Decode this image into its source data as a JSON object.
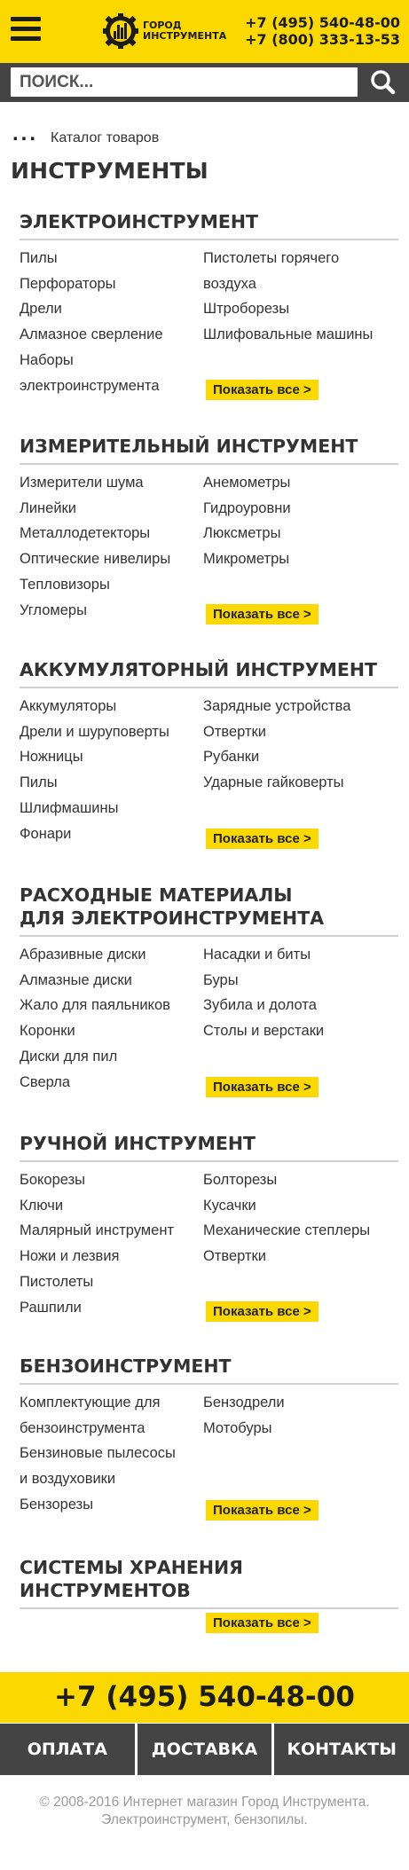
{
  "header": {
    "logo_line1": "ГОРОД",
    "logo_line2": "ИНСТРУМЕНТА",
    "phone1": "+7 (495) 540-48-00",
    "phone2": "+7 (800) 333-13-53"
  },
  "search": {
    "placeholder": "ПОИСК..."
  },
  "breadcrumb": {
    "dots": "...",
    "link": "Каталог товаров"
  },
  "page_title": "ИНСТРУМЕНТЫ",
  "show_all_label": "Показать все >",
  "sections": [
    {
      "title_lines": [
        "ЭЛЕКТРОИНСТРУМЕНТ"
      ],
      "left": [
        "Пилы",
        "Перфораторы",
        "Дрели",
        "Алмазное сверление",
        "Наборы",
        "электроинструмента"
      ],
      "right": [
        "Пистолеты горячего",
        "воздуха",
        "Штроборезы",
        "Шлифовальные машины"
      ]
    },
    {
      "title_lines": [
        "ИЗМЕРИТЕЛЬНЫЙ ИНСТРУМЕНТ"
      ],
      "left": [
        "Измерители шума",
        "Линейки",
        "Металлодетекторы",
        "Оптические нивелиры",
        "Тепловизоры",
        "Угломеры"
      ],
      "right": [
        "Анемометры",
        "Гидроуровни",
        "Люксметры",
        "Микрометры"
      ]
    },
    {
      "title_lines": [
        "АККУМУЛЯТОРНЫЙ ИНСТРУМЕНТ"
      ],
      "left": [
        "Аккумуляторы",
        "Дрели и шуруповерты",
        "Ножницы",
        "Пилы",
        "Шлифмашины",
        "Фонари"
      ],
      "right": [
        "Зарядные устройства",
        "Отвертки",
        "Рубанки",
        "Ударные гайковерты"
      ]
    },
    {
      "title_lines": [
        "РАСХОДНЫЕ МАТЕРИАЛЫ",
        "ДЛЯ ЭЛЕКТРОИНСТРУМЕНТА"
      ],
      "left": [
        "Абразивные диски",
        "Алмазные диски",
        "Жало для паяльников",
        "Коронки",
        "Диски для пил",
        "Сверла"
      ],
      "right": [
        "Насадки и биты",
        "Буры",
        "Зубила и долота",
        "Столы и верстаки"
      ]
    },
    {
      "title_lines": [
        "РУЧНОЙ ИНСТРУМЕНТ"
      ],
      "left": [
        "Бокорезы",
        "Ключи",
        "Малярный инструмент",
        "Ножи и лезвия",
        "Пистолеты",
        "Рашпили"
      ],
      "right": [
        "Болторезы",
        "Кусачки",
        "Механические степлеры",
        "Отвертки"
      ]
    },
    {
      "title_lines": [
        "БЕНЗОИНСТРУМЕНТ"
      ],
      "left": [
        "Комплектующие для",
        "бензоинструмента",
        "Бензиновые пылесосы",
        "и воздуховики",
        "Бензорезы"
      ],
      "right": [
        "Бензодрели",
        "Мотобуры"
      ]
    },
    {
      "title_lines": [
        "СИСТЕМЫ ХРАНЕНИЯ ИНСТРУМЕНТОВ"
      ],
      "left": [],
      "right": []
    }
  ],
  "big_phone": "+7 (495) 540-48-00",
  "nav": [
    "ОПЛАТА",
    "ДОСТАВКА",
    "КОНТАКТЫ"
  ],
  "footer": {
    "line1": "© 2008-2016 Интернет магазин Город Инструмента.",
    "line2": "Электроинструмент, бензопилы."
  },
  "colors": {
    "accent": "#fbd800",
    "dark": "#444444",
    "text": "#333333",
    "footer_text": "#9a9a9a"
  },
  "icons": [
    "hamburger-menu-icon",
    "logo-gear-icon",
    "search-icon"
  ]
}
